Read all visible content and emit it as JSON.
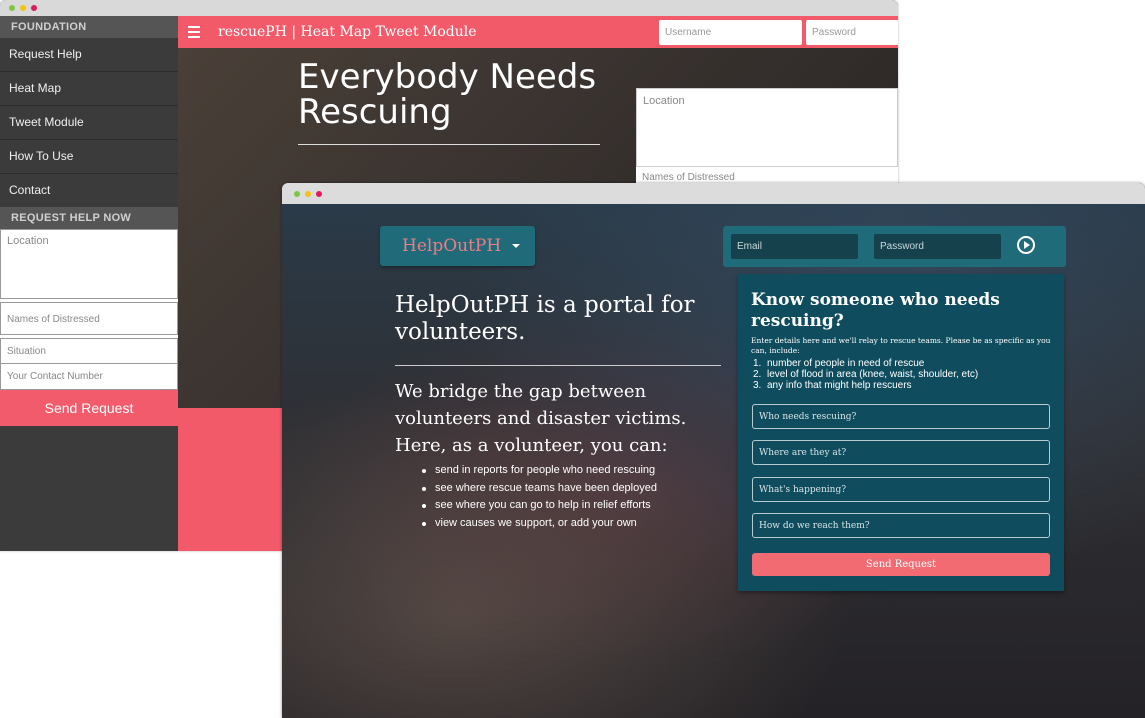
{
  "back_window": {
    "sidebar": {
      "header": "FOUNDATION",
      "items": [
        {
          "label": "Request Help"
        },
        {
          "label": "Heat Map"
        },
        {
          "label": "Tweet Module"
        },
        {
          "label": "How To Use"
        },
        {
          "label": "Contact"
        }
      ],
      "section_header": "REQUEST HELP NOW",
      "form": {
        "location_placeholder": "Location",
        "names_placeholder": "Names of Distressed",
        "situation_placeholder": "Situation",
        "contact_placeholder": "Your Contact Number",
        "submit_label": "Send Request"
      }
    },
    "topbar": {
      "title": "rescuePH | Heat Map Tweet Module",
      "username_placeholder": "Username",
      "password_placeholder": "Password"
    },
    "hero": {
      "title": "Everybody Needs Rescuing",
      "location_placeholder": "Location",
      "names_placeholder": "Names of Distressed"
    }
  },
  "front_window": {
    "brand": "HelpOutPH",
    "login": {
      "email_placeholder": "Email",
      "password_placeholder": "Password"
    },
    "hero": {
      "title": "HelpOutPH is a portal for volunteers.",
      "subtitle": "We bridge the gap between volunteers and disaster victims. Here, as a volunteer, you can:",
      "bullets": [
        "send in reports for people who need rescuing",
        "see where rescue teams have been deployed",
        "see where you can go to help in relief efforts",
        "view causes we support, or add your own"
      ]
    },
    "card": {
      "title": "Know someone who needs rescuing?",
      "intro": "Enter details here and we'll relay to rescue teams. Please be as specific as you can, include:",
      "list": [
        {
          "n": "1.",
          "text": "number of people in need of rescue"
        },
        {
          "n": "2.",
          "text": "level of flood in area (knee, waist, shoulder, etc)"
        },
        {
          "n": "3.",
          "text": "any info that might help rescuers"
        }
      ],
      "fields": [
        "Who needs rescuing?",
        "Where are they at?",
        "What's happening?",
        "How do we reach them?"
      ],
      "submit_label": "Send Request"
    }
  },
  "colors": {
    "brand_red": "#f25a6a",
    "teal": "#1f6b7a",
    "card_teal": "#0f4d5e"
  }
}
